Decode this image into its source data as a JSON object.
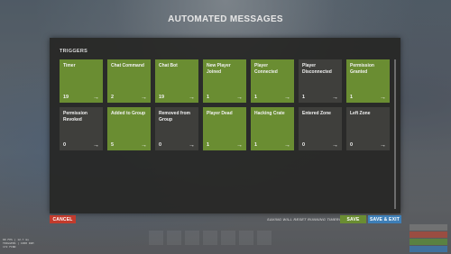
{
  "window": {
    "title": "AUTOMATED MESSAGES"
  },
  "section": {
    "header": "TRIGGERS"
  },
  "triggers": [
    {
      "label": "Timer",
      "count": "19",
      "state": "green"
    },
    {
      "label": "Chat Command",
      "count": "2",
      "state": "green"
    },
    {
      "label": "Chat Bot",
      "count": "19",
      "state": "green"
    },
    {
      "label": "New Player Joined",
      "count": "1",
      "state": "green"
    },
    {
      "label": "Player Connected",
      "count": "1",
      "state": "green"
    },
    {
      "label": "Player Disconnected",
      "count": "1",
      "state": "dark"
    },
    {
      "label": "Permission Granted",
      "count": "1",
      "state": "green"
    },
    {
      "label": "Permission Revoked",
      "count": "0",
      "state": "dark"
    },
    {
      "label": "Added to Group",
      "count": "5",
      "state": "green"
    },
    {
      "label": "Removed from Group",
      "count": "0",
      "state": "dark"
    },
    {
      "label": "Player Dead",
      "count": "1",
      "state": "green"
    },
    {
      "label": "Hacking Crate",
      "count": "1",
      "state": "green"
    },
    {
      "label": "Entered Zone",
      "count": "0",
      "state": "dark"
    },
    {
      "label": "Left Zone",
      "count": "0",
      "state": "dark"
    }
  ],
  "arrow_glyph": "→",
  "footer": {
    "cancel_label": "CANCEL",
    "reset_note": "SAVING WILL RESET RUNNING TIMERS",
    "save_label": "SAVE",
    "save_exit_label": "SAVE & EXIT"
  },
  "hud": {
    "line1": "80 FPS | 12.7 ms",
    "line2": "TRIGGERS | 1000 RAM",
    "line3": "172 FIND"
  },
  "colors": {
    "active": "#6a8d32",
    "inactive": "#3f3f3c",
    "cancel": "#c23b2d",
    "save_exit": "#3e7fb7"
  }
}
